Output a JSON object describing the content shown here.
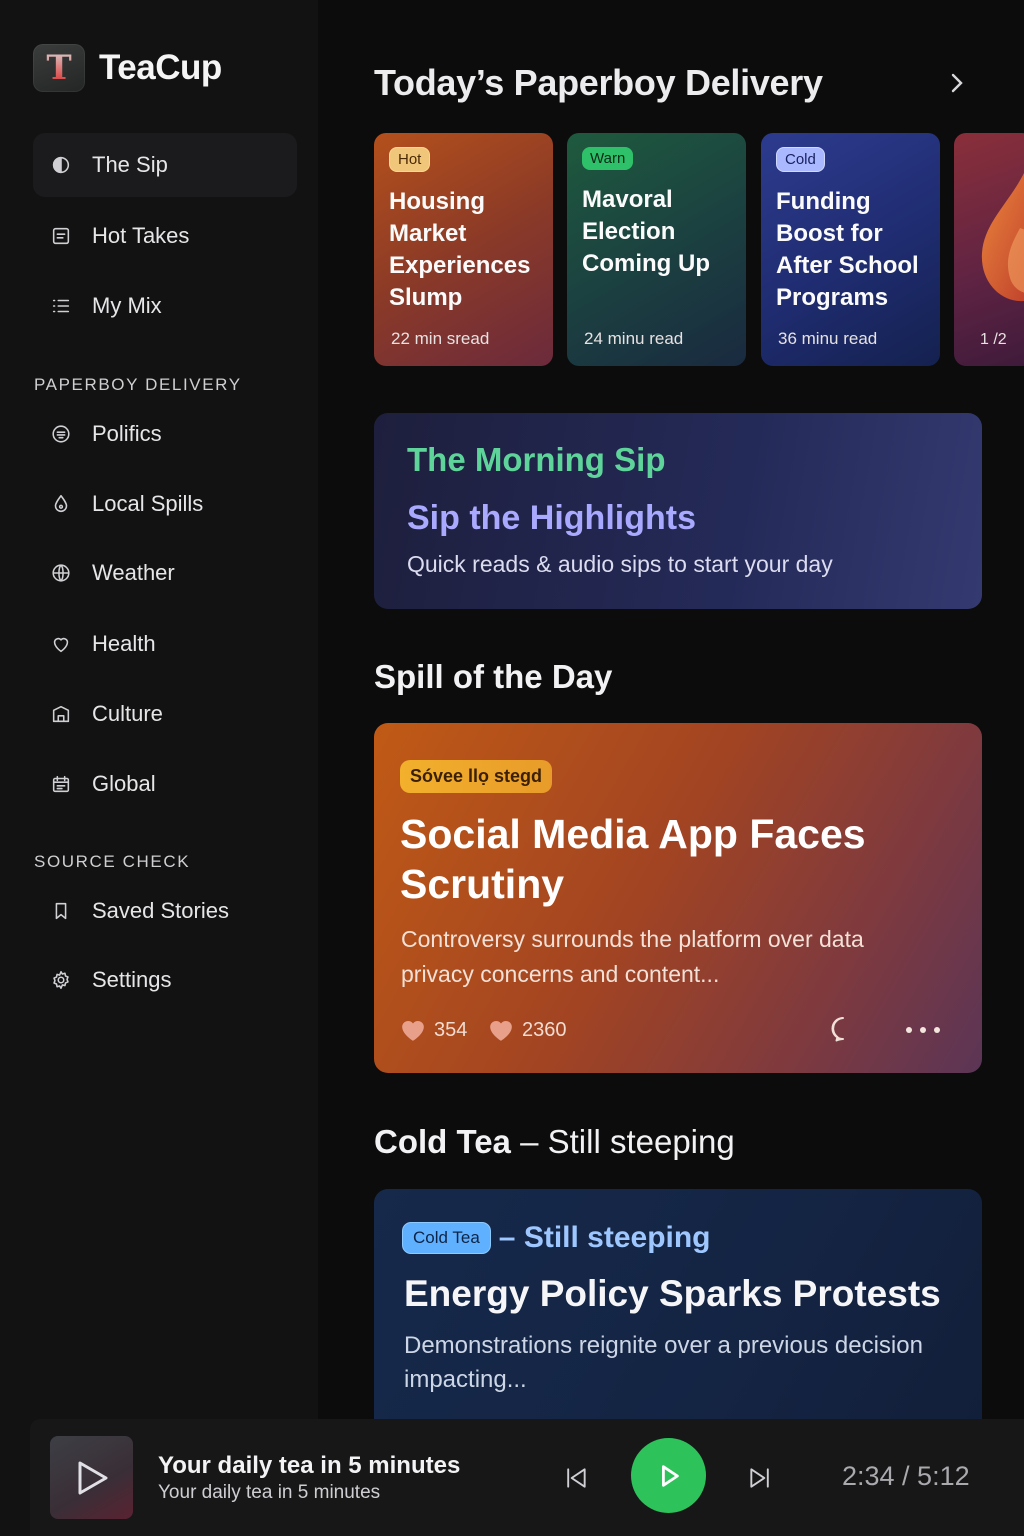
{
  "app": {
    "name": "TeaCup",
    "logo_letter": "T"
  },
  "sidebar": {
    "main_items": [
      {
        "label": "The Sip",
        "icon": "sip-icon",
        "active": true
      },
      {
        "label": "Hot Takes",
        "icon": "note-icon",
        "active": false
      },
      {
        "label": "My Mix",
        "icon": "list-icon",
        "active": false
      }
    ],
    "section1_label": "PAPERBOY DELIVERY",
    "section1_items": [
      {
        "label": "Polifics",
        "icon": "chat-icon"
      },
      {
        "label": "Local Spills",
        "icon": "drop-icon"
      },
      {
        "label": "Weather",
        "icon": "globe-icon"
      },
      {
        "label": "Health",
        "icon": "heart-icon"
      },
      {
        "label": "Culture",
        "icon": "building-icon"
      },
      {
        "label": "Global",
        "icon": "calendar-icon"
      }
    ],
    "section2_label": "SOURCE CHECK",
    "section2_items": [
      {
        "label": "Saved Stories",
        "icon": "bookmark-icon"
      },
      {
        "label": "Settings",
        "icon": "gear-icon"
      }
    ]
  },
  "delivery": {
    "title": "Today’s Paperboy Delivery",
    "cards": [
      {
        "tag": "Hot",
        "title": "Housing Market Experiences Slump",
        "meta": "22 min sread"
      },
      {
        "tag": "Warn",
        "title": "Mavoral Election Coming Up",
        "meta": "24 minu read"
      },
      {
        "tag": "Cold",
        "title": "Funding Boost for After School Programs",
        "meta": "36 minu read"
      }
    ],
    "pager": "1 /2"
  },
  "morning": {
    "title": "The Morning Sip",
    "subtitle": "Sip the Highlights",
    "desc": "Quick reads & audio sips to start your day"
  },
  "spill": {
    "heading": "Spill of the Day",
    "tag": "Sóvee llọ stegd",
    "title": "Social Media App Faces Scrutiny",
    "desc": "Controversy surrounds the platform over data privacy concerns and content...",
    "likes": "354",
    "hearts": "2360"
  },
  "cold_tea": {
    "heading_bold": "Cold Tea",
    "heading_light": "– Still steeping",
    "tag": "Cold Tea",
    "tag_suffix": "– Still steeping",
    "title": "Energy Policy Sparks Protests",
    "desc": "Demonstrations reignite over a previous decision impacting..."
  },
  "player": {
    "title": "Your daily tea in 5 minutes",
    "subtitle": "Your daily tea in 5 minutes",
    "time": "2:34 / 5:12"
  },
  "colors": {
    "accent_green": "#2ec25a",
    "hot": "#f0c77a",
    "warn": "#2fc16a",
    "cold": "#a9b8ff"
  }
}
